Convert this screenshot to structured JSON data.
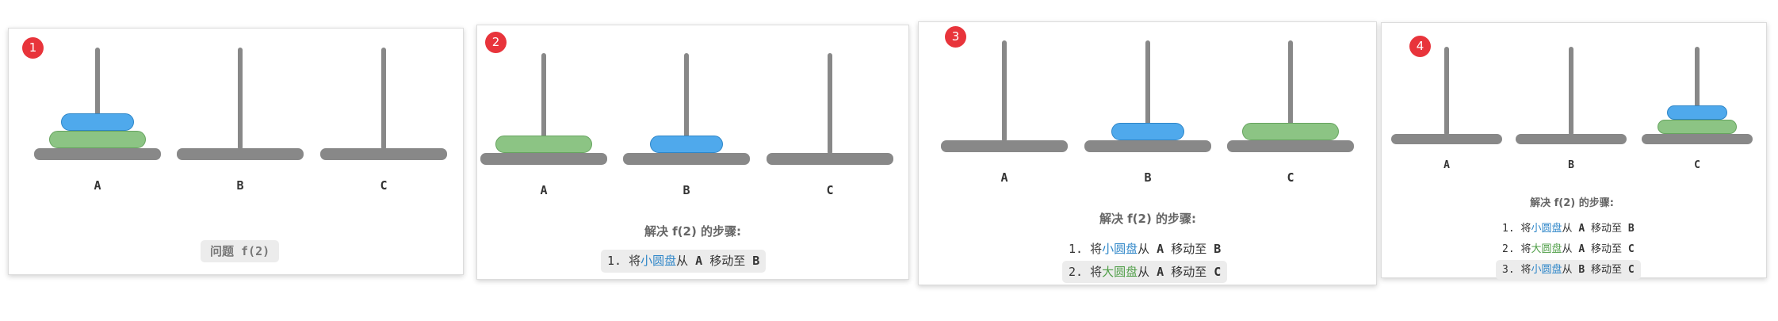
{
  "panels": [
    {
      "badge": "1",
      "pegs": [
        "A",
        "B",
        "C"
      ],
      "disks": [
        {
          "size": "small",
          "peg": "A"
        },
        {
          "size": "large",
          "peg": "A"
        }
      ],
      "question": "问题 f(2)"
    },
    {
      "badge": "2",
      "pegs": [
        "A",
        "B",
        "C"
      ],
      "disks": [
        {
          "size": "large",
          "peg": "A"
        },
        {
          "size": "small",
          "peg": "B"
        }
      ],
      "steps_title": "解决 f(2) 的步骤:",
      "steps": [
        {
          "num": "1.",
          "verb": "将",
          "disk": "小圆盘",
          "from_word": "从",
          "from": "A",
          "to_word": "移动至",
          "to": "B"
        }
      ]
    },
    {
      "badge": "3",
      "pegs": [
        "A",
        "B",
        "C"
      ],
      "disks": [
        {
          "size": "small",
          "peg": "B"
        },
        {
          "size": "large",
          "peg": "C"
        }
      ],
      "steps_title": "解决 f(2) 的步骤:",
      "steps": [
        {
          "num": "1.",
          "verb": "将",
          "disk": "小圆盘",
          "from_word": "从",
          "from": "A",
          "to_word": "移动至",
          "to": "B"
        },
        {
          "num": "2.",
          "verb": "将",
          "disk": "大圆盘",
          "from_word": "从",
          "from": "A",
          "to_word": "移动至",
          "to": "C"
        }
      ]
    },
    {
      "badge": "4",
      "pegs": [
        "A",
        "B",
        "C"
      ],
      "disks": [
        {
          "size": "small",
          "peg": "C"
        },
        {
          "size": "large",
          "peg": "C"
        }
      ],
      "steps_title": "解决 f(2) 的步骤:",
      "steps": [
        {
          "num": "1.",
          "verb": "将",
          "disk": "小圆盘",
          "from_word": "从",
          "from": "A",
          "to_word": "移动至",
          "to": "B"
        },
        {
          "num": "2.",
          "verb": "将",
          "disk": "大圆盘",
          "from_word": "从",
          "from": "A",
          "to_word": "移动至",
          "to": "C"
        },
        {
          "num": "3.",
          "verb": "将",
          "disk": "小圆盘",
          "from_word": "从",
          "from": "B",
          "to_word": "移动至",
          "to": "C"
        }
      ]
    }
  ],
  "colors": {
    "small_disk": "#4fa9ec",
    "large_disk": "#8cc484",
    "badge": "#e8343b",
    "peg": "#888888"
  }
}
